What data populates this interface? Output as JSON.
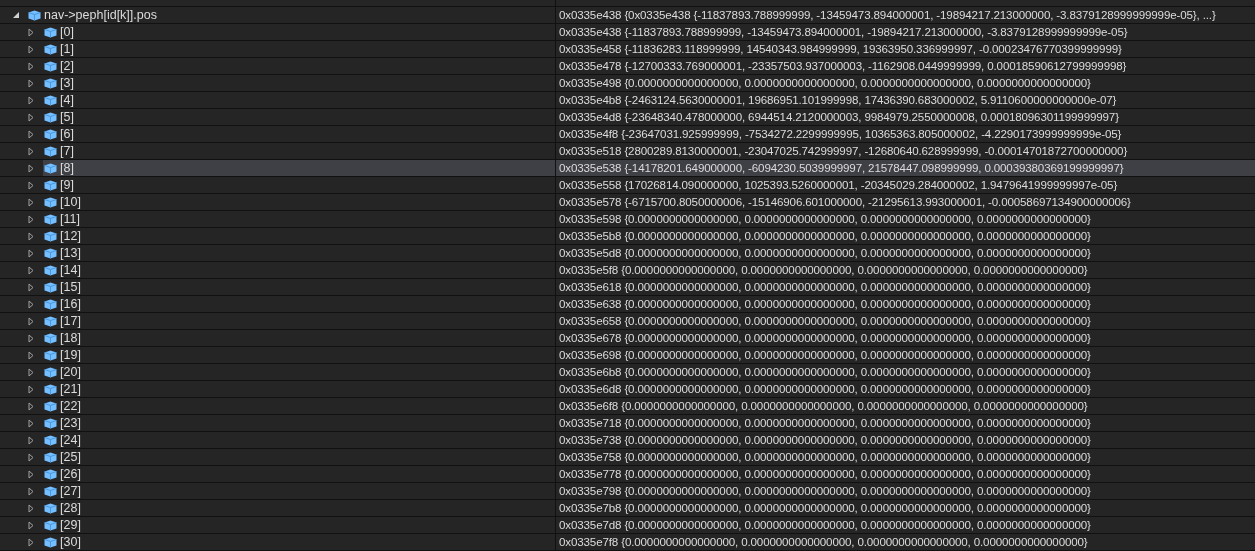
{
  "watch": {
    "name": "nav->peph[id[k]].pos",
    "expanded": true,
    "value": "0x0335e438 {0x0335e438 {-11837893.788999999, -13459473.894000001, -19894217.213000000, -3.8379128999999999e-05}, ...}",
    "children": [
      {
        "name": "[0]",
        "expanded": false,
        "selected": false,
        "value": "0x0335e438 {-11837893.788999999, -13459473.894000001, -19894217.213000000, -3.8379128999999999e-05}"
      },
      {
        "name": "[1]",
        "expanded": false,
        "selected": false,
        "value": "0x0335e458 {-11836283.118999999, 14540343.984999999, 19363950.336999997, -0.00023476770399999999}"
      },
      {
        "name": "[2]",
        "expanded": false,
        "selected": false,
        "value": "0x0335e478 {-12700333.769000001, -23357503.937000003, -1162908.0449999999, 0.00018590612799999998}"
      },
      {
        "name": "[3]",
        "expanded": false,
        "selected": false,
        "value": "0x0335e498 {0.0000000000000000, 0.0000000000000000, 0.0000000000000000, 0.0000000000000000}"
      },
      {
        "name": "[4]",
        "expanded": false,
        "selected": false,
        "value": "0x0335e4b8 {-2463124.5630000001, 19686951.101999998, 17436390.683000002, 5.9110600000000000e-07}"
      },
      {
        "name": "[5]",
        "expanded": false,
        "selected": false,
        "value": "0x0335e4d8 {-23648340.478000000, 6944514.2120000003, 9984979.2550000008, 0.00018096301199999997}"
      },
      {
        "name": "[6]",
        "expanded": false,
        "selected": false,
        "value": "0x0335e4f8 {-23647031.925999999, -7534272.2299999995, 10365363.805000002, -4.2290173999999999e-05}"
      },
      {
        "name": "[7]",
        "expanded": false,
        "selected": false,
        "value": "0x0335e518 {2800289.8130000001, -23047025.742999997, -12680640.628999999, -0.00014701872700000000}"
      },
      {
        "name": "[8]",
        "expanded": false,
        "selected": true,
        "value": "0x0335e538 {-14178201.649000000, -6094230.5039999997, 21578447.098999999, 0.00039380369199999997}"
      },
      {
        "name": "[9]",
        "expanded": false,
        "selected": false,
        "value": "0x0335e558 {17026814.090000000, 1025393.5260000001, -20345029.284000002, 1.9479641999999997e-05}"
      },
      {
        "name": "[10]",
        "expanded": false,
        "selected": false,
        "value": "0x0335e578 {-6715700.8050000006, -15146906.601000000, -21295613.993000001, -0.00058697134900000006}"
      },
      {
        "name": "[11]",
        "expanded": false,
        "selected": false,
        "value": "0x0335e598 {0.0000000000000000, 0.0000000000000000, 0.0000000000000000, 0.0000000000000000}"
      },
      {
        "name": "[12]",
        "expanded": false,
        "selected": false,
        "value": "0x0335e5b8 {0.0000000000000000, 0.0000000000000000, 0.0000000000000000, 0.0000000000000000}"
      },
      {
        "name": "[13]",
        "expanded": false,
        "selected": false,
        "value": "0x0335e5d8 {0.0000000000000000, 0.0000000000000000, 0.0000000000000000, 0.0000000000000000}"
      },
      {
        "name": "[14]",
        "expanded": false,
        "selected": false,
        "value": "0x0335e5f8 {0.0000000000000000, 0.0000000000000000, 0.0000000000000000, 0.0000000000000000}"
      },
      {
        "name": "[15]",
        "expanded": false,
        "selected": false,
        "value": "0x0335e618 {0.0000000000000000, 0.0000000000000000, 0.0000000000000000, 0.0000000000000000}"
      },
      {
        "name": "[16]",
        "expanded": false,
        "selected": false,
        "value": "0x0335e638 {0.0000000000000000, 0.0000000000000000, 0.0000000000000000, 0.0000000000000000}"
      },
      {
        "name": "[17]",
        "expanded": false,
        "selected": false,
        "value": "0x0335e658 {0.0000000000000000, 0.0000000000000000, 0.0000000000000000, 0.0000000000000000}"
      },
      {
        "name": "[18]",
        "expanded": false,
        "selected": false,
        "value": "0x0335e678 {0.0000000000000000, 0.0000000000000000, 0.0000000000000000, 0.0000000000000000}"
      },
      {
        "name": "[19]",
        "expanded": false,
        "selected": false,
        "value": "0x0335e698 {0.0000000000000000, 0.0000000000000000, 0.0000000000000000, 0.0000000000000000}"
      },
      {
        "name": "[20]",
        "expanded": false,
        "selected": false,
        "value": "0x0335e6b8 {0.0000000000000000, 0.0000000000000000, 0.0000000000000000, 0.0000000000000000}"
      },
      {
        "name": "[21]",
        "expanded": false,
        "selected": false,
        "value": "0x0335e6d8 {0.0000000000000000, 0.0000000000000000, 0.0000000000000000, 0.0000000000000000}"
      },
      {
        "name": "[22]",
        "expanded": false,
        "selected": false,
        "value": "0x0335e6f8 {0.0000000000000000, 0.0000000000000000, 0.0000000000000000, 0.0000000000000000}"
      },
      {
        "name": "[23]",
        "expanded": false,
        "selected": false,
        "value": "0x0335e718 {0.0000000000000000, 0.0000000000000000, 0.0000000000000000, 0.0000000000000000}"
      },
      {
        "name": "[24]",
        "expanded": false,
        "selected": false,
        "value": "0x0335e738 {0.0000000000000000, 0.0000000000000000, 0.0000000000000000, 0.0000000000000000}"
      },
      {
        "name": "[25]",
        "expanded": false,
        "selected": false,
        "value": "0x0335e758 {0.0000000000000000, 0.0000000000000000, 0.0000000000000000, 0.0000000000000000}"
      },
      {
        "name": "[26]",
        "expanded": false,
        "selected": false,
        "value": "0x0335e778 {0.0000000000000000, 0.0000000000000000, 0.0000000000000000, 0.0000000000000000}"
      },
      {
        "name": "[27]",
        "expanded": false,
        "selected": false,
        "value": "0x0335e798 {0.0000000000000000, 0.0000000000000000, 0.0000000000000000, 0.0000000000000000}"
      },
      {
        "name": "[28]",
        "expanded": false,
        "selected": false,
        "value": "0x0335e7b8 {0.0000000000000000, 0.0000000000000000, 0.0000000000000000, 0.0000000000000000}"
      },
      {
        "name": "[29]",
        "expanded": false,
        "selected": false,
        "value": "0x0335e7d8 {0.0000000000000000, 0.0000000000000000, 0.0000000000000000, 0.0000000000000000}"
      },
      {
        "name": "[30]",
        "expanded": false,
        "selected": false,
        "value": "0x0335e7f8 {0.0000000000000000, 0.0000000000000000, 0.0000000000000000, 0.0000000000000000}"
      }
    ]
  }
}
